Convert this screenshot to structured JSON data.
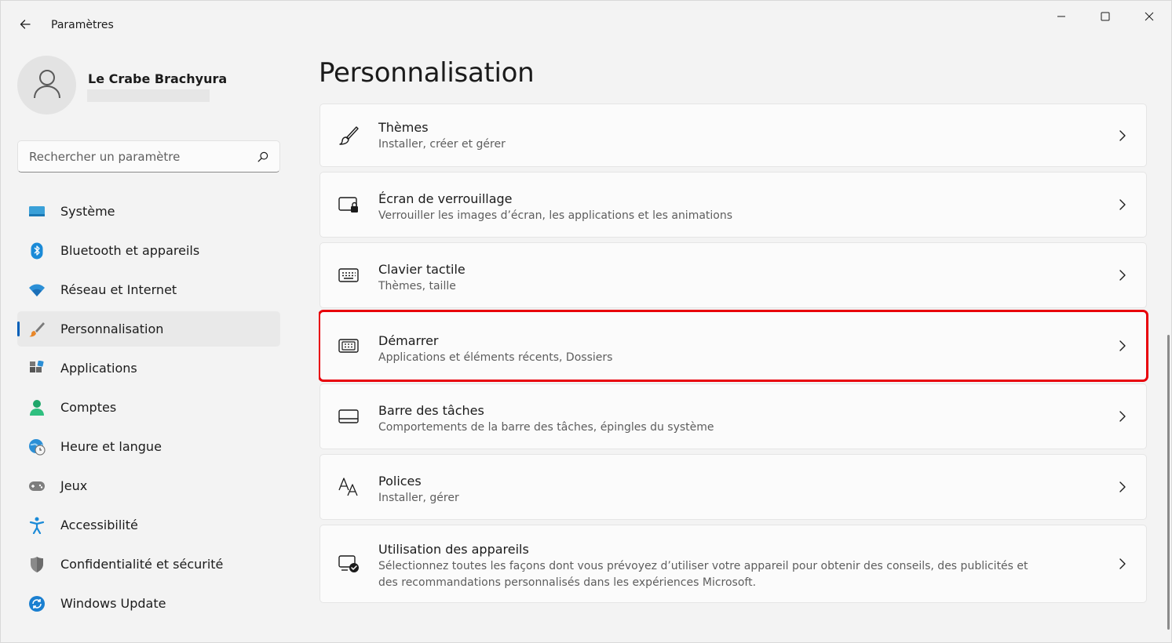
{
  "window": {
    "title": "Paramètres",
    "back_icon": "arrow-left-icon",
    "controls": [
      "minimize-icon",
      "maximize-icon",
      "close-icon"
    ]
  },
  "profile": {
    "name": "Le Crabe Brachyura",
    "avatar_icon": "person-icon"
  },
  "search": {
    "placeholder": "Rechercher un paramètre",
    "value": "",
    "icon": "search-icon"
  },
  "sidebar": {
    "active_index": 3,
    "accent": "#005fb8",
    "items": [
      {
        "label": "Système",
        "icon": "monitor-icon"
      },
      {
        "label": "Bluetooth et appareils",
        "icon": "bluetooth-icon"
      },
      {
        "label": "Réseau et Internet",
        "icon": "wifi-icon"
      },
      {
        "label": "Personnalisation",
        "icon": "paintbrush-icon"
      },
      {
        "label": "Applications",
        "icon": "apps-icon"
      },
      {
        "label": "Comptes",
        "icon": "account-icon"
      },
      {
        "label": "Heure et langue",
        "icon": "globe-clock-icon"
      },
      {
        "label": "Jeux",
        "icon": "gamepad-icon"
      },
      {
        "label": "Accessibilité",
        "icon": "accessibility-icon"
      },
      {
        "label": "Confidentialité et sécurité",
        "icon": "shield-icon"
      },
      {
        "label": "Windows Update",
        "icon": "update-icon"
      }
    ]
  },
  "main": {
    "title": "Personnalisation",
    "highlight_color": "#e8000a",
    "cards": [
      {
        "title": "Thèmes",
        "subtitle": "Installer, créer et gérer",
        "icon": "brush-icon"
      },
      {
        "title": "Écran de verrouillage",
        "subtitle": "Verrouiller les images d’écran, les applications et les animations",
        "icon": "lock-screen-icon"
      },
      {
        "title": "Clavier tactile",
        "subtitle": "Thèmes, taille",
        "icon": "keyboard-icon"
      },
      {
        "title": "Démarrer",
        "subtitle": "Applications et éléments récents, Dossiers",
        "icon": "start-menu-icon",
        "highlighted": true
      },
      {
        "title": "Barre des tâches",
        "subtitle": "Comportements de la barre des tâches, épingles du système",
        "icon": "taskbar-icon"
      },
      {
        "title": "Polices",
        "subtitle": "Installer, gérer",
        "icon": "fonts-icon"
      },
      {
        "title": "Utilisation des appareils",
        "subtitle": "Sélectionnez toutes les façons dont vous prévoyez d’utiliser votre appareil pour obtenir des conseils, des publicités et des recommandations personnalisés dans les expériences Microsoft.",
        "icon": "device-usage-icon"
      }
    ]
  }
}
